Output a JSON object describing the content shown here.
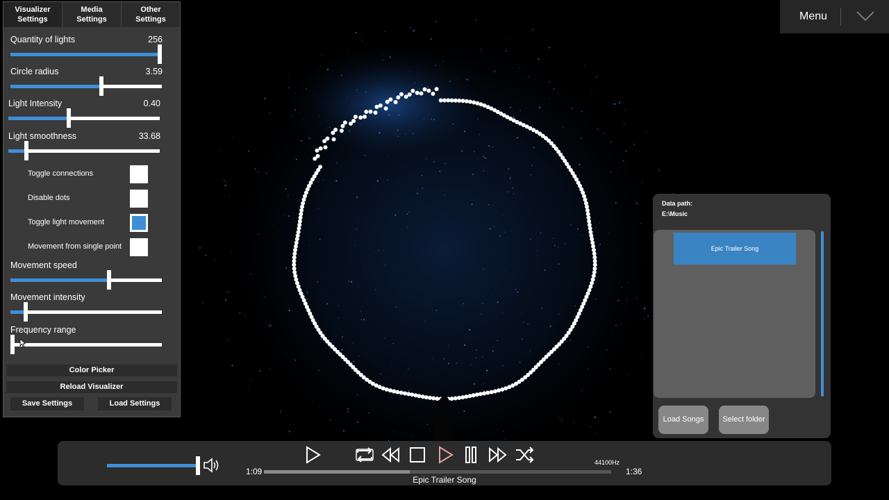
{
  "tabs": [
    {
      "label": "Visualizer\nSettings"
    },
    {
      "label": "Media\nSettings"
    },
    {
      "label": "Other\nSettings"
    }
  ],
  "sliders": [
    {
      "label": "Quantity of lights",
      "value": "256",
      "fraction": 1.0
    },
    {
      "label": "Circle radius",
      "value": "3.59",
      "fraction": 0.6
    },
    {
      "label": "Light Intensity",
      "value": "0.40",
      "fraction": 0.4
    },
    {
      "label": "Light smoothness",
      "value": "33.68",
      "fraction": 0.12
    },
    {
      "label": "Movement speed",
      "value": "",
      "fraction": 0.65
    },
    {
      "label": "Movement intensity",
      "value": "",
      "fraction": 0.1
    },
    {
      "label": "Frequency range",
      "value": "",
      "fraction": 0.0
    }
  ],
  "toggles": [
    {
      "label": "Toggle connections",
      "checked": false
    },
    {
      "label": "Disable dots",
      "checked": false
    },
    {
      "label": "Toggle light movement",
      "checked": true
    },
    {
      "label": "Movement from single point",
      "checked": false
    }
  ],
  "buttons": {
    "color_picker": "Color Picker",
    "reload": "Reload Visualizer",
    "save": "Save Settings",
    "load": "Load Settings"
  },
  "menu": {
    "label": "Menu",
    "icon": "chevron-down-icon"
  },
  "song_panel": {
    "path_label": "Data path:",
    "path_value": "E:\\Music",
    "songs": [
      "Epic Trailer Song"
    ],
    "load_songs": "Load Songs",
    "select_folder": "Select folder"
  },
  "player": {
    "current_time": "1:09",
    "total_time": "1:36",
    "progress": 0.42,
    "volume": 1.0,
    "sample_rate": "44100Hz",
    "track_title": "Epic Trailer Song"
  },
  "colors": {
    "accent": "#3f8fd6",
    "panel": "#3a3a3a",
    "glow": "#2a5fa8"
  }
}
